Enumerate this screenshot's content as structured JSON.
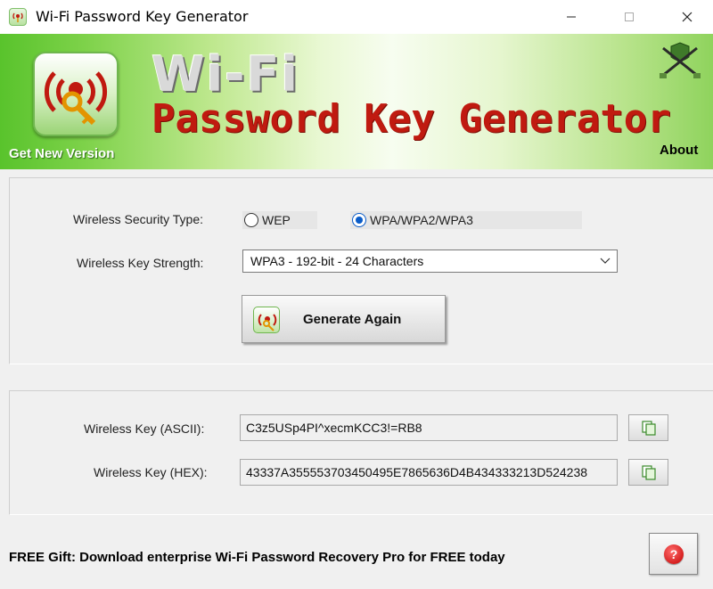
{
  "window": {
    "title": "Wi-Fi Password Key Generator",
    "controls": [
      "minimize",
      "maximize",
      "close"
    ]
  },
  "banner": {
    "title_line1": "Wi-Fi",
    "title_line2": "Password Key Generator",
    "get_new_version": "Get New Version",
    "about": "About",
    "icons": [
      "wifi-key-logo-icon",
      "crossed-swords-emblem-icon"
    ]
  },
  "settings": {
    "security_type_label": "Wireless Security Type:",
    "security_options": [
      {
        "label": "WEP",
        "selected": false
      },
      {
        "label": "WPA/WPA2/WPA3",
        "selected": true
      }
    ],
    "key_strength_label": "Wireless Key Strength:",
    "key_strength_value": "WPA3 - 192-bit - 24 Characters",
    "generate_button": "Generate Again"
  },
  "results": {
    "ascii_label": "Wireless Key (ASCII):",
    "ascii_value": "C3z5USp4PI^xecmKCC3!=RB8",
    "hex_label": "Wireless Key (HEX):",
    "hex_value": "43337A355553703450495E7865636D4B434333213D524238"
  },
  "footer": {
    "gift_text": "FREE Gift: Download enterprise Wi-Fi Password Recovery Pro for FREE today",
    "help_symbol": "?"
  },
  "colors": {
    "accent_red": "#c01a10",
    "banner_green": "#59c32c",
    "radio_blue": "#0a5cc8"
  }
}
